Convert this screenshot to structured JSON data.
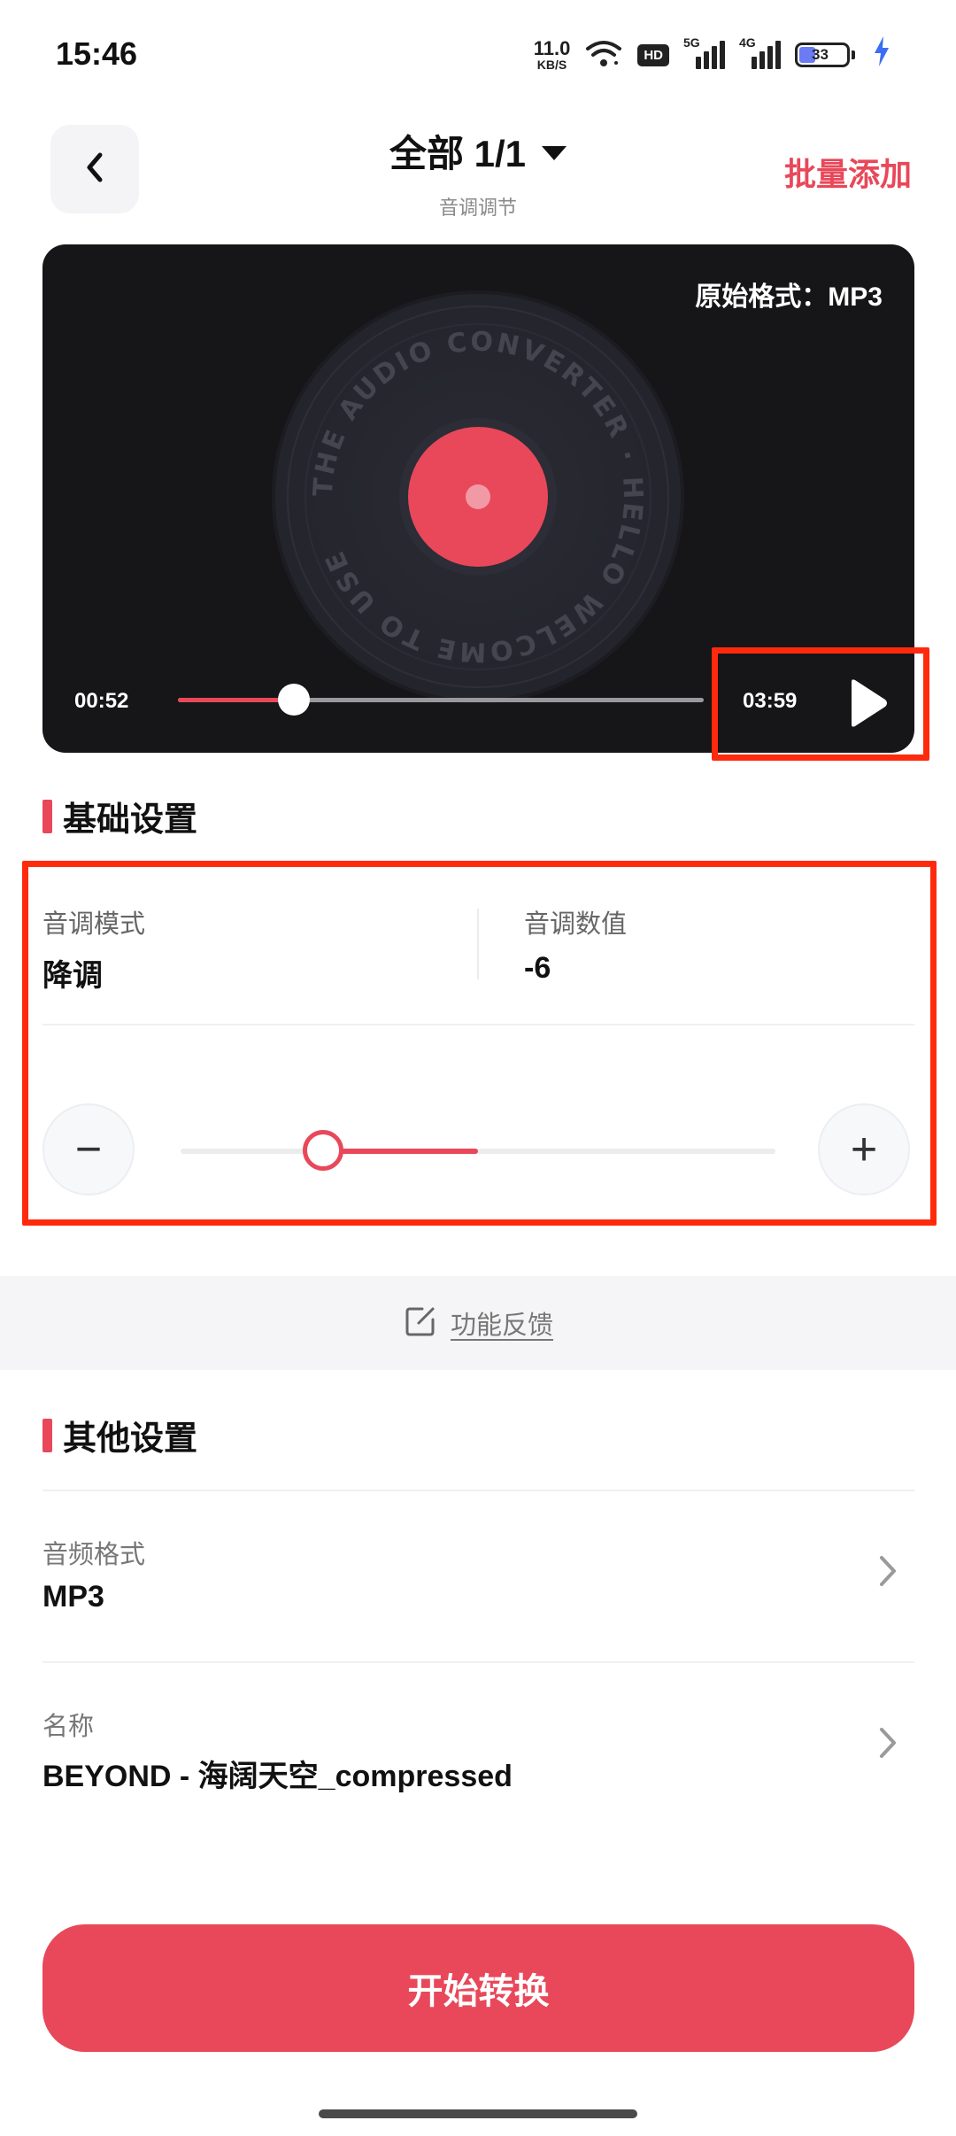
{
  "status_bar": {
    "time": "15:46",
    "net_speed": "11.0",
    "net_speed_unit": "KB/S",
    "hd_label": "HD",
    "sig1_tag": "5G",
    "sig2_tag": "4G",
    "battery": "33"
  },
  "header": {
    "title": "全部 1/1",
    "subtitle": "音调调节",
    "batch_add": "批量添加"
  },
  "player": {
    "original_format": "原始格式：MP3",
    "current_time": "00:52",
    "total_time": "03:59",
    "progress": 0.22,
    "vinyl_text": "THE AUDIO CONVERTER · HELLO WELCOME TO USE "
  },
  "basic_settings": {
    "title": "基础设置",
    "pitch_mode_label": "音调模式",
    "pitch_mode_value": "降调",
    "pitch_value_label": "音调数值",
    "pitch_value": "-6",
    "minus_symbol": "−",
    "plus_symbol": "+",
    "slider_value": 0.24,
    "slider_center": 0.5
  },
  "feedback": {
    "label": "功能反馈"
  },
  "other_settings": {
    "title": "其他设置",
    "rows": [
      {
        "label": "音频格式",
        "value": "MP3"
      },
      {
        "label": "名称",
        "value": "BEYOND - 海阔天空_compressed"
      }
    ]
  },
  "start_button": {
    "label": "开始转换"
  },
  "colors": {
    "accent": "#e8485a",
    "highlight": "#ff2a0d",
    "player_bg": "#161618"
  }
}
